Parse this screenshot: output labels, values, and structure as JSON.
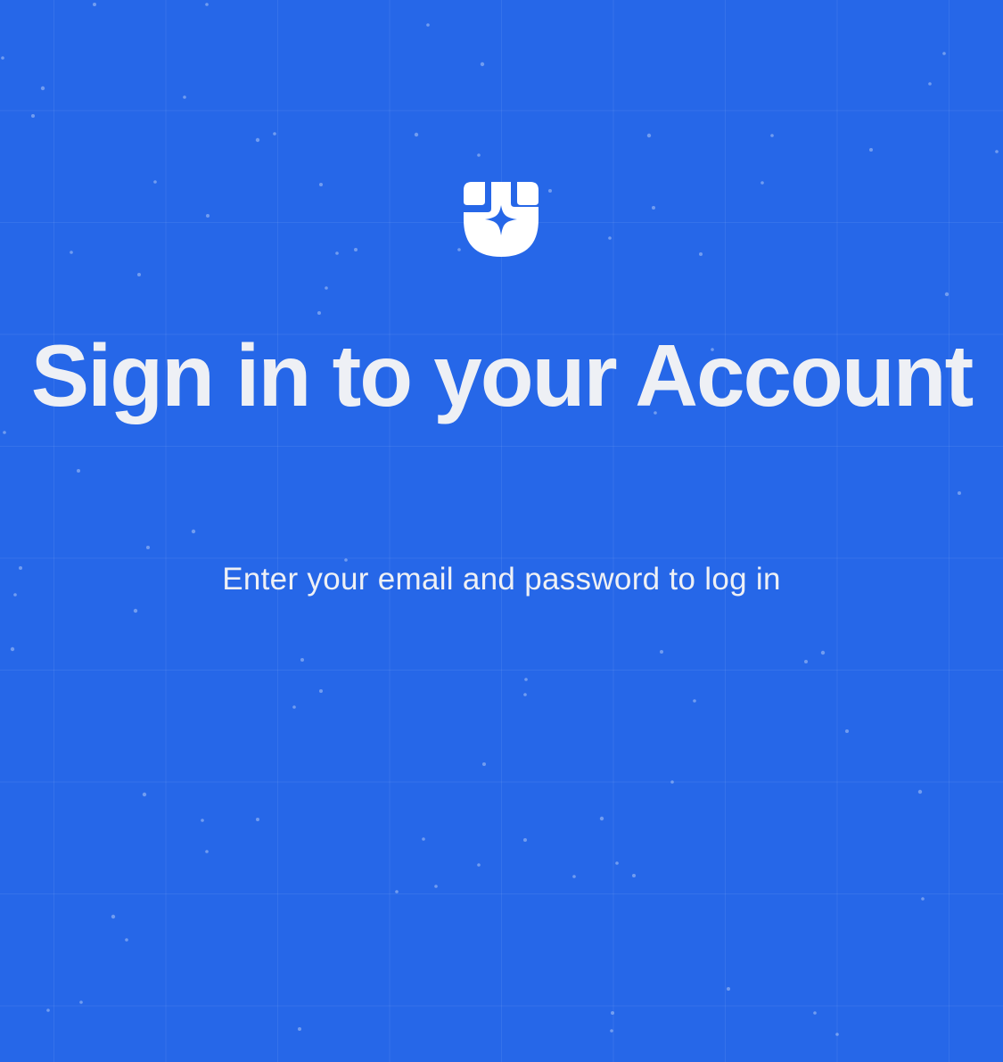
{
  "colors": {
    "background": "#2667e8",
    "text": "#eef0f5",
    "logo_fill": "#ffffff"
  },
  "logo": {
    "icon": "shield-sparkle-icon"
  },
  "heading": {
    "title": "Sign in to your Account",
    "subtitle": "Enter your email and password to log in"
  }
}
